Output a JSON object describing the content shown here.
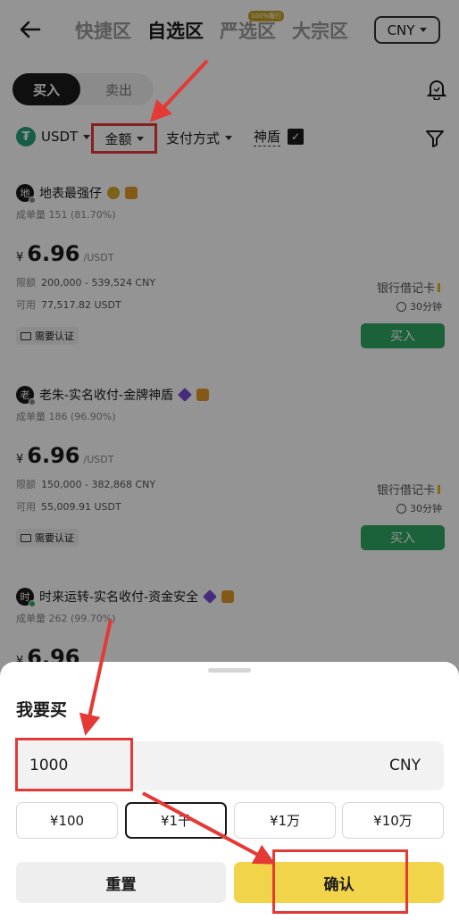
{
  "header": {
    "zones": [
      "快捷区",
      "自选区",
      "严选区",
      "大宗区"
    ],
    "active_zone": "自选区",
    "zone_badge": "100%履行",
    "currency": "CNY"
  },
  "trade_toggle": {
    "buy": "买入",
    "sell": "卖出"
  },
  "filters": {
    "coin": "USDT",
    "amount": "金额",
    "payment": "支付方式",
    "shield": "神盾",
    "shield_checked": true
  },
  "listings": [
    {
      "avatar": "地",
      "name": "地表最强仔",
      "online": false,
      "stats_label": "成单量",
      "stats_value": "151 (81.70%)",
      "currency_symbol": "¥",
      "price": "6.96",
      "price_unit": "/USDT",
      "limit_label": "限额",
      "limit": "200,000 - 539,524 CNY",
      "available_label": "可用",
      "available": "77,517.82 USDT",
      "payment": "银行借记卡",
      "time": "30分钟",
      "verify": "需要认证",
      "buy": "买入"
    },
    {
      "avatar": "老",
      "name": "老朱-实名收付-金牌神盾",
      "online": false,
      "stats_label": "成单量",
      "stats_value": "186 (96.90%)",
      "currency_symbol": "¥",
      "price": "6.96",
      "price_unit": "/USDT",
      "limit_label": "限额",
      "limit": "150,000 - 382,868 CNY",
      "available_label": "可用",
      "available": "55,009.91 USDT",
      "payment": "银行借记卡",
      "time": "30分钟",
      "verify": "需要认证",
      "buy": "买入"
    },
    {
      "avatar": "时",
      "name": "时来运转-实名收付-资金安全",
      "online": true,
      "stats_label": "成单量",
      "stats_value": "262 (99.70%)",
      "currency_symbol": "¥",
      "price": "6.96"
    }
  ],
  "sheet": {
    "title": "我要买",
    "amount": "1000",
    "currency": "CNY",
    "quick_amounts": [
      "¥100",
      "¥1千",
      "¥1万",
      "¥10万"
    ],
    "selected_quick": "¥1千",
    "reset": "重置",
    "confirm": "确认"
  },
  "colors": {
    "buy_green": "#2fa865",
    "confirm_yellow": "#f2d44b",
    "annotation_red": "#e53935"
  }
}
